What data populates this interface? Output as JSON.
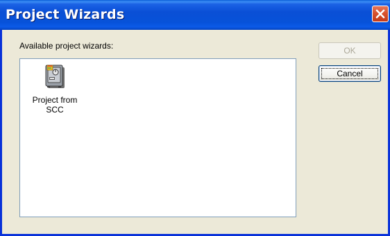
{
  "window": {
    "title": "Project Wizards"
  },
  "dialog": {
    "prompt": "Available project wizards:",
    "wizards": [
      {
        "label": "Project from\nSCC",
        "icon": "safe-project-icon",
        "selected": false
      }
    ]
  },
  "buttons": {
    "ok_label": "OK",
    "ok_enabled": false,
    "cancel_label": "Cancel"
  },
  "colors": {
    "titlebar": "#0a4fd6",
    "close_button": "#d8532f",
    "dialog_bg": "#ece9d8",
    "listbox_border": "#7f9db9"
  }
}
